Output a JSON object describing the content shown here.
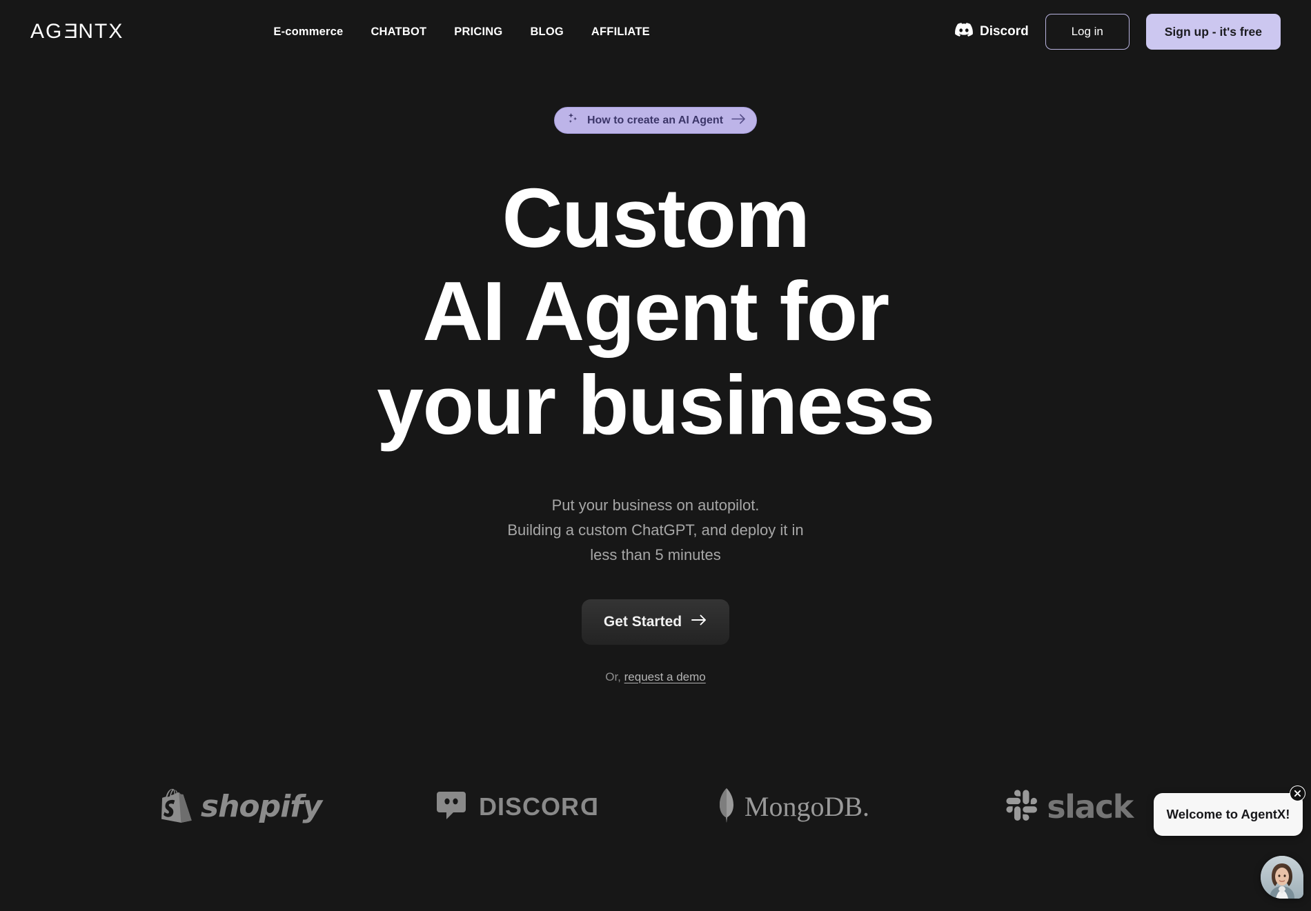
{
  "header": {
    "logo": "AGENTX",
    "nav": [
      {
        "label": "E-commerce"
      },
      {
        "label": "CHATBOT"
      },
      {
        "label": "PRICING"
      },
      {
        "label": "BLOG"
      },
      {
        "label": "AFFILIATE"
      }
    ],
    "discord_label": "Discord",
    "login_label": "Log in",
    "signup_label": "Sign up - it's free"
  },
  "hero": {
    "badge_label": "How to create an AI Agent",
    "title_line1": "Custom",
    "title_line2": "AI Agent for",
    "title_line3": "your business",
    "sub_line1": "Put your business on autopilot.",
    "sub_line2": "Building a custom ChatGPT, and deploy it in",
    "sub_line3": "less than 5 minutes",
    "cta_label": "Get Started",
    "demo_prefix": "Or,",
    "demo_link": "request a demo"
  },
  "logos": [
    {
      "name": "shopify",
      "label": "shopify"
    },
    {
      "name": "discord",
      "label": "DISCORD"
    },
    {
      "name": "mongodb",
      "label": "MongoDB."
    },
    {
      "name": "slack",
      "label": "slack"
    }
  ],
  "chat": {
    "welcome_message": "Welcome to AgentX!"
  },
  "colors": {
    "background": "#171717",
    "accent_lavender": "#ccc7f0",
    "badge_bg": "#bdb4e8",
    "badge_text": "#3b3568",
    "text_primary": "#ffffff",
    "text_muted": "#a7a7a7"
  }
}
